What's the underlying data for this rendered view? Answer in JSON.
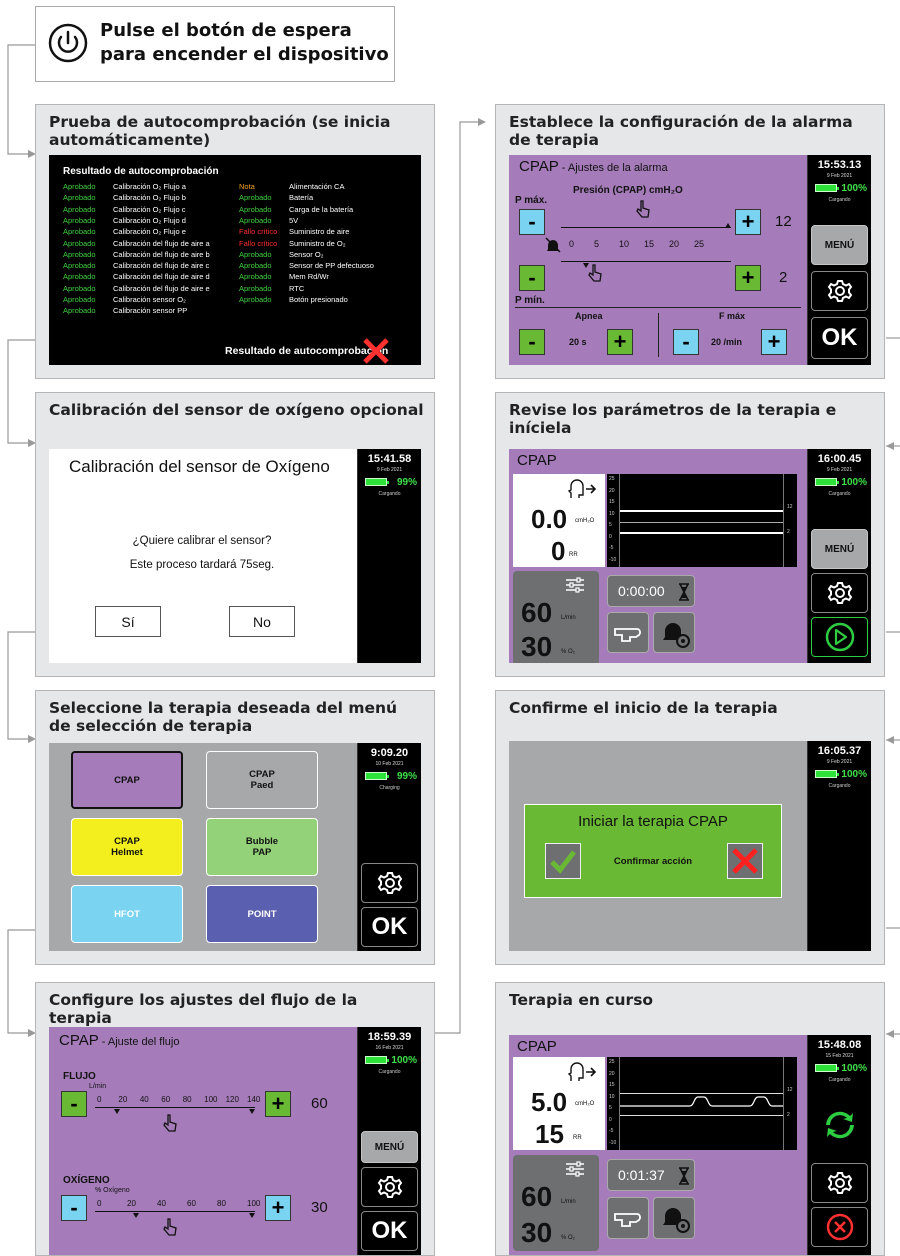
{
  "intro": {
    "text": "Pulse el botón de espera para encender el dispositivo"
  },
  "p1": {
    "title": "Prueba de autocomprobación (se inicia automáticamente)",
    "heading": "Resultado de autocomprobación",
    "left_rows": [
      {
        "status": "Aprobado",
        "label": "Calibración O₂ Flujo a"
      },
      {
        "status": "Aprobado",
        "label": "Calibración O₂ Flujo b"
      },
      {
        "status": "Aprobado",
        "label": "Calibración O₂ Flujo c"
      },
      {
        "status": "Aprobado",
        "label": "Calibración O₂ Flujo d"
      },
      {
        "status": "Aprobado",
        "label": "Calibración O₂ Flujo e"
      },
      {
        "status": "Aprobado",
        "label": "Calibración del flujo de aire a"
      },
      {
        "status": "Aprobado",
        "label": "Calibración del flujo de aire b"
      },
      {
        "status": "Aprobado",
        "label": "Calibración del flujo de aire c"
      },
      {
        "status": "Aprobado",
        "label": "Calibración del flujo de aire d"
      },
      {
        "status": "Aprobado",
        "label": "Calibración del flujo de aire e"
      },
      {
        "status": "Aprobado",
        "label": "Calibración sensor O₂"
      },
      {
        "status": "Aprobado",
        "label": "Calibración sensor PP"
      }
    ],
    "right_rows": [
      {
        "status": "Nota",
        "label": "Alimentación CA"
      },
      {
        "status": "Aprobado",
        "label": "Batería"
      },
      {
        "status": "Aprobado",
        "label": "Carga de la batería"
      },
      {
        "status": "Aprobado",
        "label": "5V"
      },
      {
        "status": "Fallo crítico",
        "label": "Suministro de aire"
      },
      {
        "status": "Fallo crítico",
        "label": "Suministro de O₂"
      },
      {
        "status": "Aprobado",
        "label": "Sensor O₂"
      },
      {
        "status": "Aprobado",
        "label": "Sensor de PP defectuoso"
      },
      {
        "status": "Aprobado",
        "label": "Mem Rd/Wr"
      },
      {
        "status": "Aprobado",
        "label": "RTC"
      },
      {
        "status": "Aprobado",
        "label": "Botón presionado"
      }
    ],
    "footer": "Resultado de autocomprobación",
    "colors": {
      "pass": "#3fd23f",
      "note": "#f0a020",
      "fail": "#ff3030"
    }
  },
  "p2": {
    "title": "Calibración del sensor de oxígeno opcional",
    "screen_title": "Calibración del sensor de Oxígeno",
    "question": "¿Quiere calibrar el sensor?",
    "note": "Este proceso tardará 75seg.",
    "yes": "Sí",
    "no": "No",
    "time": "15:41.58",
    "date": "9 Feb 2021",
    "battery": "99%",
    "charge": "Cargando"
  },
  "p3": {
    "title": "Seleccione la terapia deseada del menú de selección de terapia",
    "options": [
      "CPAP",
      "CPAP\nPaed",
      "CPAP\nHelmet",
      "Bubble\nPAP",
      "HFOT",
      "POINT"
    ],
    "time": "9:09.20",
    "date": "10 Feb 2021",
    "battery": "99%",
    "charge": "Charging",
    "ok": "OK"
  },
  "p4": {
    "title": "Configure los ajustes del flujo de la terapia",
    "mode": "CPAP",
    "sub": " - Ajuste del flujo",
    "flow_label": "FLUJO",
    "flow_unit": "L/min",
    "flow_ticks": [
      "0",
      "20",
      "40",
      "60",
      "80",
      "100",
      "120",
      "140"
    ],
    "flow_value": "60",
    "oxy_label": "OXÍGENO",
    "oxy_unit": "% Oxígeno",
    "oxy_ticks": [
      "0",
      "20",
      "40",
      "60",
      "80",
      "100"
    ],
    "oxy_value": "30",
    "time": "18:59.39",
    "date": "16 Feb 2021",
    "battery": "100%",
    "charge": "Cargando",
    "menu": "MENÚ",
    "ok": "OK"
  },
  "p5": {
    "title": "Establece la configuración de la alarma de terapia",
    "mode": "CPAP",
    "sub": " - Ajustes de la alarma",
    "pmax": "P máx.",
    "pmin": "P mín.",
    "pressure_label": "Presión (CPAP) cmH₂O",
    "ticks": [
      "0",
      "5",
      "10",
      "15",
      "20",
      "25"
    ],
    "max_value": "12",
    "min_value": "2",
    "apnea_label": "Apnea",
    "apnea_value": "20 s",
    "fmax_label": "F máx",
    "fmax_value": "20 /min",
    "time": "15:53.13",
    "date": "9 Feb 2021",
    "battery": "100%",
    "charge": "Cargando",
    "menu": "MENÚ",
    "ok": "OK"
  },
  "p6": {
    "title": "Revise los parámetros de la terapia e iníciela",
    "mode": "CPAP",
    "pressure": "0.0",
    "pressure_unit": "cmH₂O",
    "rr": "0",
    "rr_unit": "RR",
    "flow": "60",
    "flow_unit": "L/min",
    "oxy": "30",
    "oxy_unit": "% O₂",
    "timer": "0:00:00",
    "graph_ticks": [
      "25",
      "20",
      "15",
      "10",
      "5",
      "0",
      "-5",
      "-10"
    ],
    "graph_right": [
      "12",
      "2"
    ],
    "time": "16:00.45",
    "date": "9 Feb 2021",
    "battery": "100%",
    "charge": "Cargando",
    "menu": "MENÚ"
  },
  "p7": {
    "title": "Confirme el inicio de la terapia",
    "dialog_title": "Iniciar la terapia CPAP",
    "confirm": "Confirmar acción",
    "time": "16:05.37",
    "date": "9 Feb 2021",
    "battery": "100%",
    "charge": "Cargando"
  },
  "p8": {
    "title": "Terapia en curso",
    "mode": "CPAP",
    "pressure": "5.0",
    "pressure_unit": "cmH₂O",
    "rr": "15",
    "rr_unit": "RR",
    "flow": "60",
    "flow_unit": "L/min",
    "oxy": "30",
    "oxy_unit": "% O₂",
    "timer": "0:01:37",
    "graph_ticks": [
      "25",
      "20",
      "15",
      "10",
      "5",
      "0",
      "-5",
      "-10"
    ],
    "graph_right": [
      "12",
      "2"
    ],
    "time": "15:48.08",
    "date": "15 Feb 2021",
    "battery": "100%",
    "charge": "Cargando"
  }
}
